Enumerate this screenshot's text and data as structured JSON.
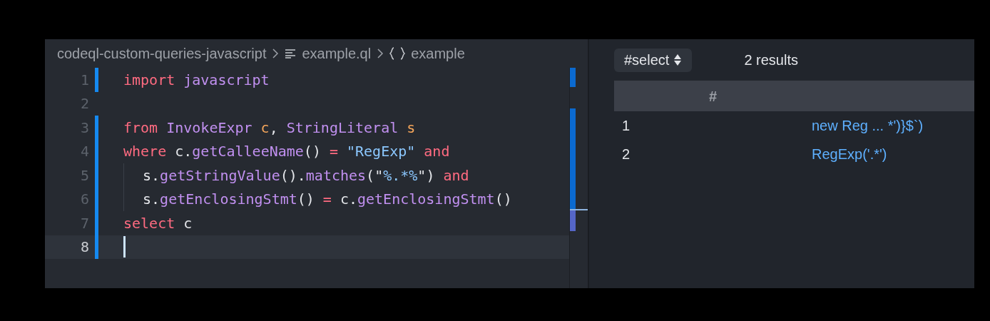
{
  "breadcrumbs": [
    {
      "kind": "folder",
      "label": "codeql-custom-queries-javascript"
    },
    {
      "kind": "file",
      "label": "example.ql"
    },
    {
      "kind": "module",
      "label": "example"
    }
  ],
  "editor": {
    "lines": [
      {
        "number": "1",
        "changed": true,
        "current": false,
        "indented": false,
        "words": [
          [
            {
              "kind": "keyword",
              "text": "import"
            }
          ],
          [
            {
              "kind": "type",
              "text": "javascript"
            }
          ]
        ]
      },
      {
        "number": "2",
        "changed": false,
        "current": false,
        "indented": false
      },
      {
        "number": "3",
        "changed": true,
        "current": false,
        "indented": false,
        "words": [
          [
            {
              "kind": "keyword",
              "text": "from"
            }
          ],
          [
            {
              "kind": "type",
              "text": "InvokeExpr"
            }
          ],
          [
            {
              "kind": "variable",
              "text": "c"
            },
            {
              "kind": "plain",
              "text": ","
            }
          ],
          [
            {
              "kind": "type",
              "text": "StringLiteral"
            }
          ],
          [
            {
              "kind": "variable",
              "text": "s"
            }
          ]
        ]
      },
      {
        "number": "4",
        "changed": true,
        "current": false,
        "indented": false,
        "words": [
          [
            {
              "kind": "keyword",
              "text": "where"
            }
          ],
          [
            {
              "kind": "plain",
              "text": "c."
            },
            {
              "kind": "function",
              "text": "getCalleeName"
            },
            {
              "kind": "plain",
              "text": "()"
            }
          ],
          [
            {
              "kind": "keyword",
              "text": "="
            }
          ],
          [
            {
              "kind": "string",
              "text": "\"RegExp\""
            }
          ],
          [
            {
              "kind": "keyword",
              "text": "and"
            }
          ]
        ]
      },
      {
        "number": "5",
        "changed": true,
        "current": false,
        "indented": true,
        "words": [
          [
            {
              "kind": "plain",
              "text": "s."
            },
            {
              "kind": "function",
              "text": "getStringValue"
            },
            {
              "kind": "plain",
              "text": "()."
            },
            {
              "kind": "function",
              "text": "matches"
            },
            {
              "kind": "plain",
              "text": "(\""
            },
            {
              "kind": "string",
              "text": "%.*%"
            },
            {
              "kind": "plain",
              "text": "\")"
            }
          ],
          [
            {
              "kind": "keyword",
              "text": "and"
            }
          ]
        ]
      },
      {
        "number": "6",
        "changed": true,
        "current": false,
        "indented": true,
        "words": [
          [
            {
              "kind": "plain",
              "text": "s."
            },
            {
              "kind": "function",
              "text": "getEnclosingStmt"
            },
            {
              "kind": "plain",
              "text": "()"
            }
          ],
          [
            {
              "kind": "keyword",
              "text": "="
            }
          ],
          [
            {
              "kind": "plain",
              "text": "c."
            },
            {
              "kind": "function",
              "text": "getEnclosingStmt"
            },
            {
              "kind": "plain",
              "text": "()"
            }
          ]
        ]
      },
      {
        "number": "7",
        "changed": true,
        "current": false,
        "indented": false,
        "words": [
          [
            {
              "kind": "keyword",
              "text": "select"
            }
          ],
          [
            {
              "kind": "plain",
              "text": "c"
            }
          ]
        ]
      },
      {
        "number": "8",
        "changed": true,
        "current": true,
        "indented": false
      }
    ]
  },
  "results": {
    "result_set": "#select",
    "count": "2 results",
    "columns": [
      "#"
    ],
    "rows": [
      {
        "index": "1",
        "value": "new Reg ... *')}$`)"
      },
      {
        "index": "2",
        "value": "RegExp('.*')"
      }
    ]
  }
}
